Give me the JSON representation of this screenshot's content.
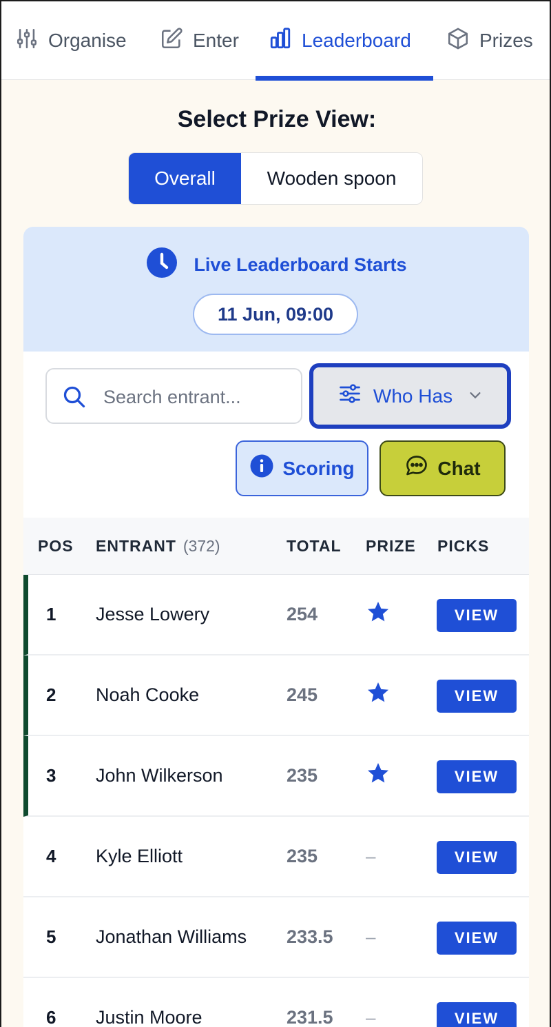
{
  "nav": {
    "tabs": [
      {
        "label": "Organise",
        "icon": "sliders-icon"
      },
      {
        "label": "Enter",
        "icon": "edit-icon"
      },
      {
        "label": "Leaderboard",
        "icon": "bar-chart-icon",
        "active": true
      },
      {
        "label": "Prizes",
        "icon": "box-icon"
      }
    ]
  },
  "prize_view": {
    "title": "Select Prize View:",
    "options": [
      "Overall",
      "Wooden spoon"
    ],
    "selected": "Overall"
  },
  "live": {
    "title": "Live Leaderboard Starts",
    "date": "11 Jun, 09:00"
  },
  "controls": {
    "search_placeholder": "Search entrant...",
    "who_has": "Who Has",
    "scoring": "Scoring",
    "chat": "Chat"
  },
  "table": {
    "headers": {
      "pos": "POS",
      "entrant": "ENTRANT",
      "entrant_count": "(372)",
      "total": "TOTAL",
      "prize": "PRIZE",
      "picks": "PICKS"
    },
    "view_label": "VIEW",
    "rows": [
      {
        "pos": "1",
        "name": "Jesse Lowery",
        "total": "254",
        "prize": true
      },
      {
        "pos": "2",
        "name": "Noah Cooke",
        "total": "245",
        "prize": true
      },
      {
        "pos": "3",
        "name": "John Wilkerson",
        "total": "235",
        "prize": true
      },
      {
        "pos": "4",
        "name": "Kyle Elliott",
        "total": "235",
        "prize": false,
        "prize_text": "–"
      },
      {
        "pos": "5",
        "name": "Jonathan Williams",
        "total": "233.5",
        "prize": false,
        "prize_text": "–"
      },
      {
        "pos": "6",
        "name": "Justin Moore",
        "total": "231.5",
        "prize": false,
        "prize_text": "–"
      }
    ]
  },
  "colors": {
    "accent": "#1f4fd6",
    "banner_bg": "#dbe8fb",
    "chat_bg": "#c7cf3a",
    "prize_marker": "#0f4a2e",
    "page_bg": "#fdf9f1"
  }
}
